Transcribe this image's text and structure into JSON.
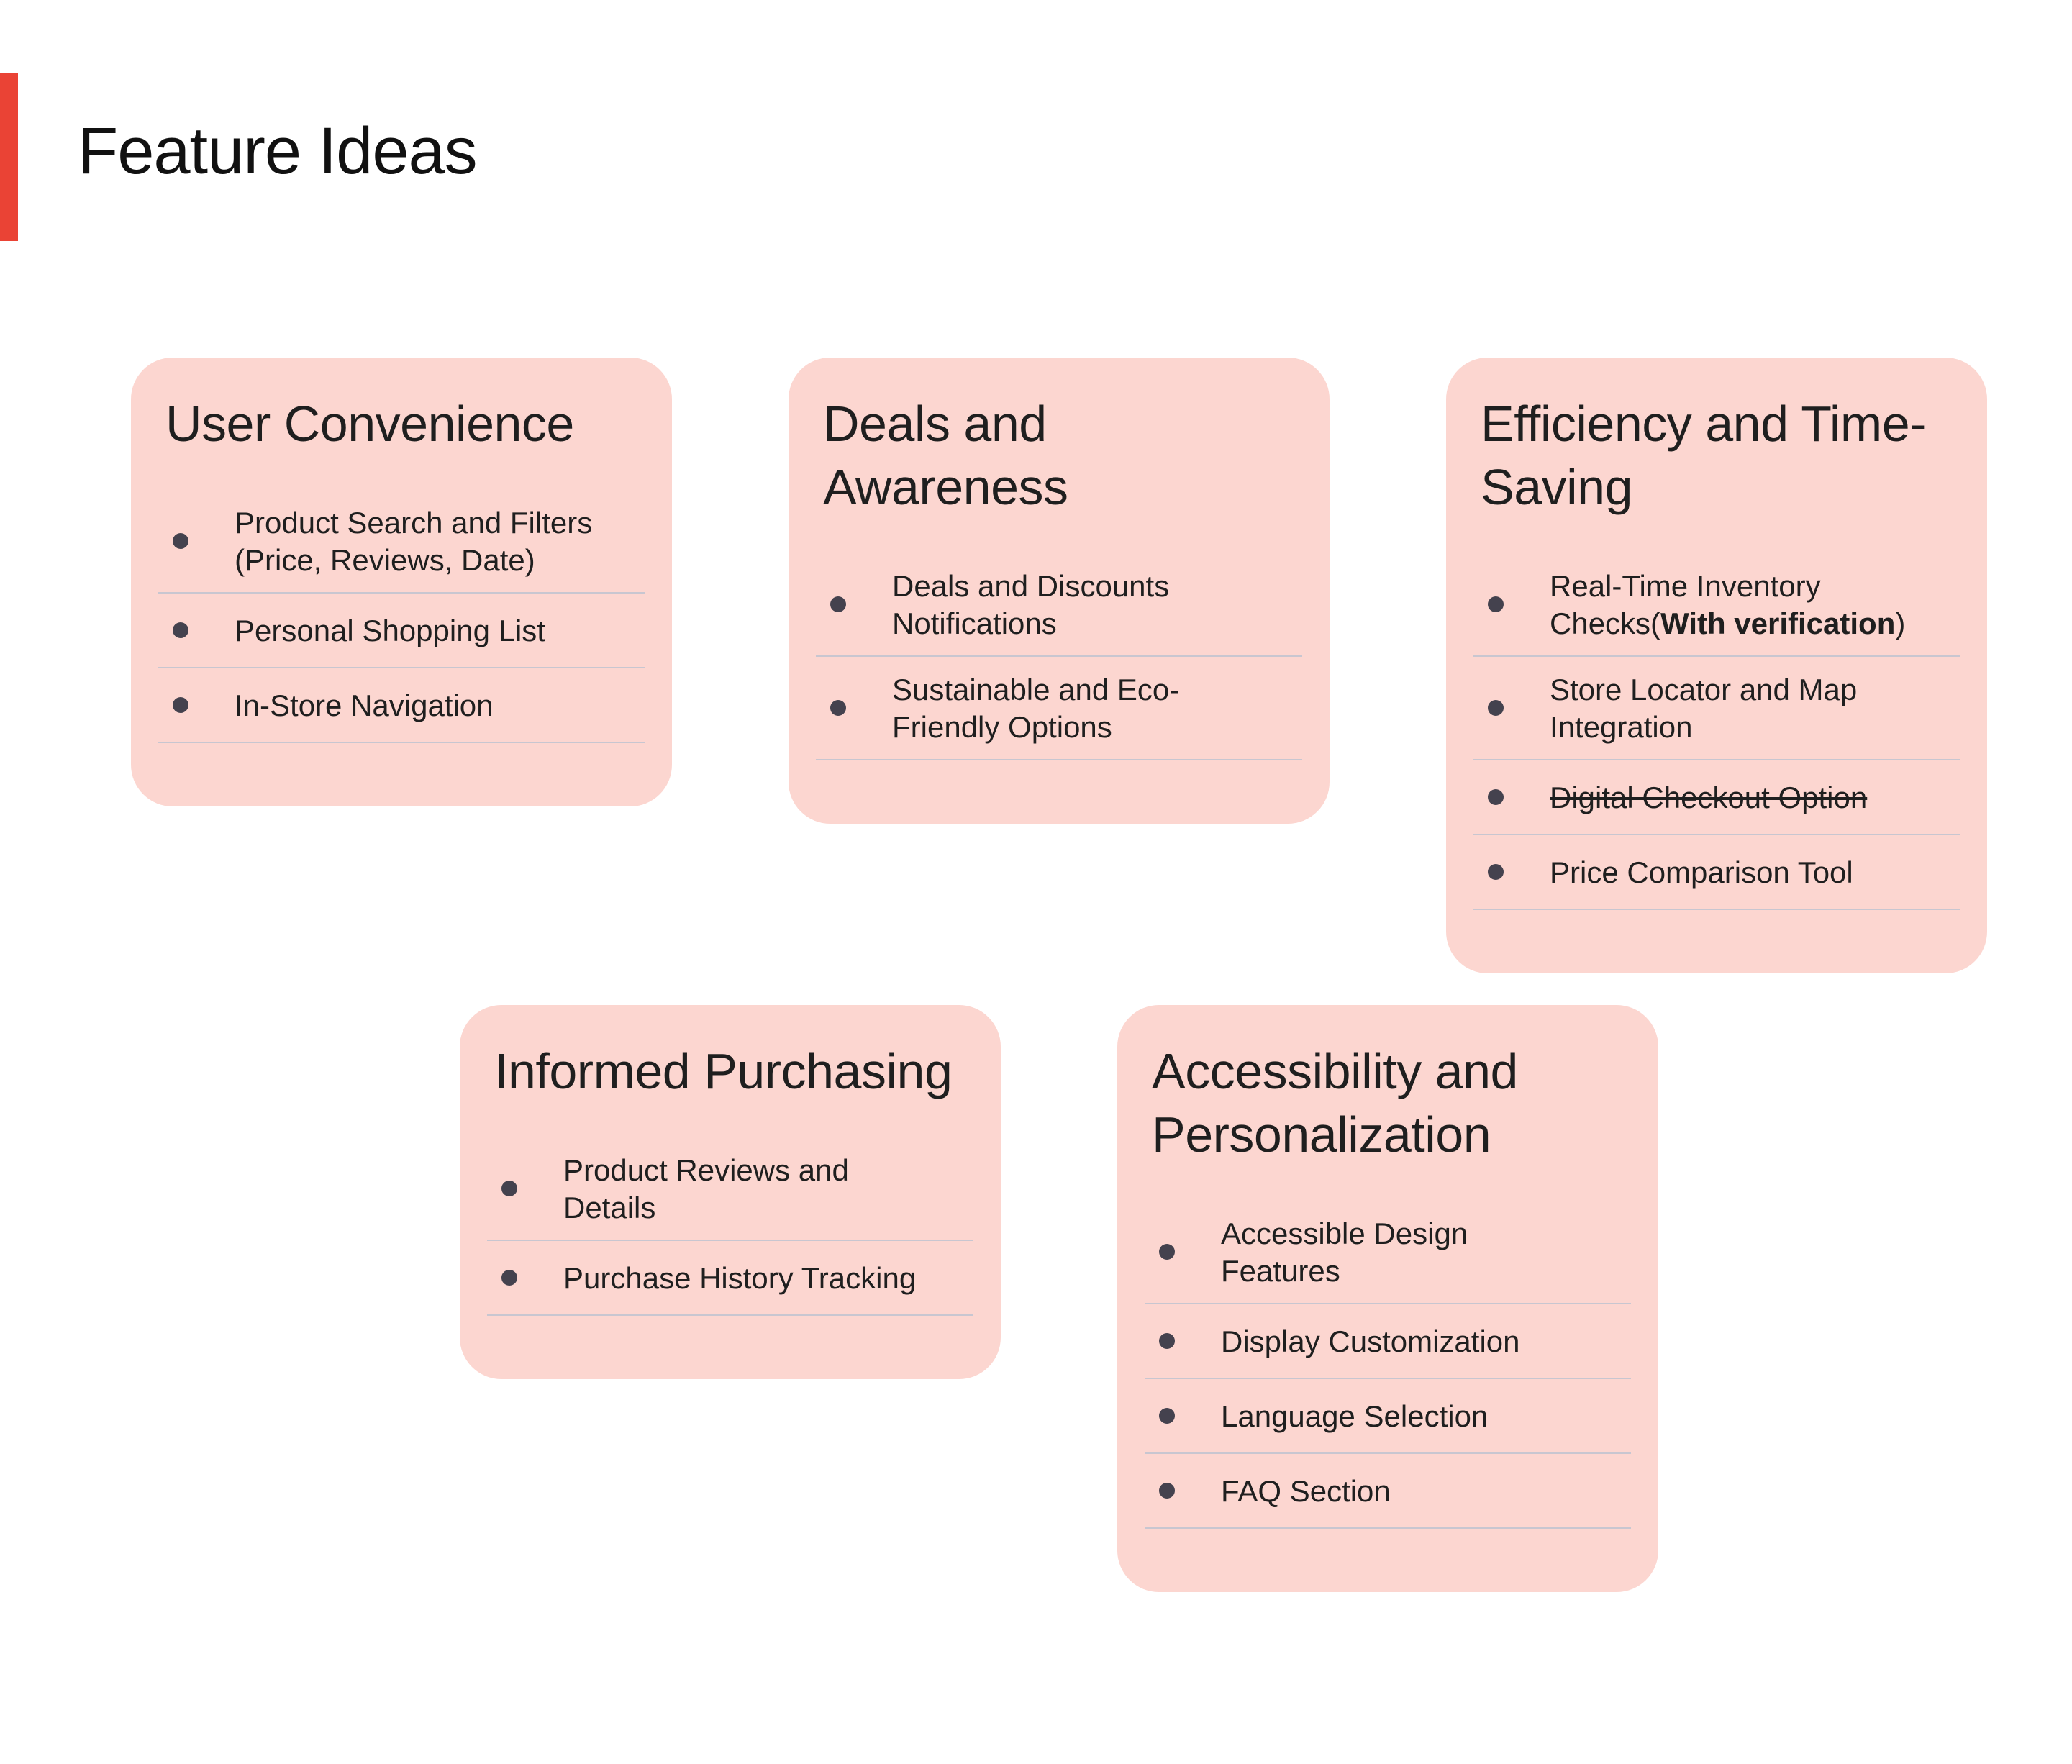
{
  "page": {
    "title": "Feature Ideas",
    "accent_color": "#ea4335",
    "card_color": "#fcd6d0",
    "bullet_color": "#44424e"
  },
  "cards": [
    {
      "title": "User Convenience",
      "items": [
        {
          "text": "Product Search and Filters (Price, Reviews, Date)"
        },
        {
          "text": "Personal Shopping List"
        },
        {
          "text": "In-Store Navigation"
        }
      ]
    },
    {
      "title": "Deals and Awareness",
      "items": [
        {
          "text": "Deals and Discounts Notifications"
        },
        {
          "text": "Sustainable and Eco-Friendly Options"
        }
      ]
    },
    {
      "title": "Efficiency and Time-Saving",
      "items": [
        {
          "text_before": "Real-Time Inventory Checks(",
          "text_bold": "With verification",
          "text_after": ")"
        },
        {
          "text": "Store Locator and Map Integration"
        },
        {
          "text": "Digital Checkout Option",
          "strikethrough": true
        },
        {
          "text": "Price Comparison Tool"
        }
      ]
    },
    {
      "title": "Informed Purchasing",
      "items": [
        {
          "text": "Product Reviews and Details"
        },
        {
          "text": "Purchase History Tracking"
        }
      ]
    },
    {
      "title": "Accessibility and Personalization",
      "items": [
        {
          "text": "Accessible Design Features"
        },
        {
          "text": "Display Customization"
        },
        {
          "text": "Language Selection"
        },
        {
          "text": "FAQ Section"
        }
      ]
    }
  ]
}
